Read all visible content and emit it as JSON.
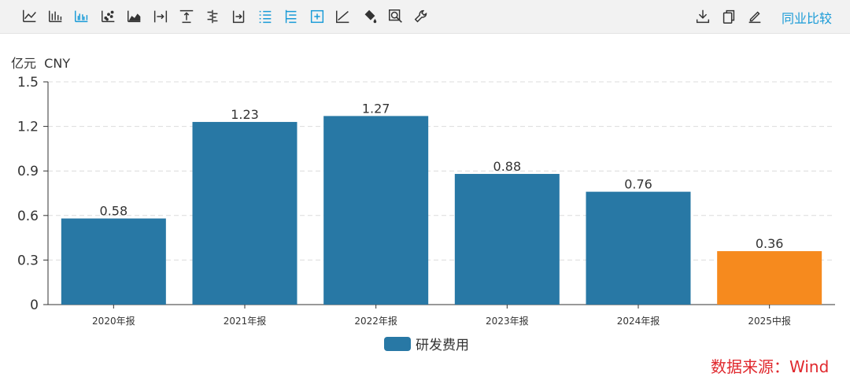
{
  "toolbar": {
    "left_tools": [
      {
        "icon": "line-chart-icon"
      },
      {
        "icon": "bar-chart-icon"
      },
      {
        "icon": "grouped-bar-chart-icon",
        "active": true
      },
      {
        "icon": "scatter-chart-icon"
      },
      {
        "icon": "area-chart-icon"
      },
      {
        "icon": "align-right-icon"
      },
      {
        "icon": "align-top-icon"
      },
      {
        "icon": "center-align-icon"
      },
      {
        "icon": "align-right-bar-icon"
      },
      {
        "icon": "list-lines-icon",
        "active": true
      },
      {
        "icon": "list-indent-icon",
        "active": true
      },
      {
        "icon": "add-box-icon",
        "active": true
      },
      {
        "icon": "trend-line-icon"
      },
      {
        "icon": "fill-color-icon"
      },
      {
        "icon": "zoom-icon"
      },
      {
        "icon": "wrench-icon"
      }
    ],
    "right_tools": [
      {
        "icon": "download-icon"
      },
      {
        "icon": "copy-icon"
      },
      {
        "icon": "edit-icon"
      }
    ],
    "peer_compare_label": "同业比较"
  },
  "colors": {
    "bar": "#2878a5",
    "highlight_bar": "#f68a1e",
    "source_text": "#e0282d",
    "active_icon": "#1a9bd7",
    "icon": "#333333"
  },
  "chart_data": {
    "type": "bar",
    "unit_label": "亿元  CNY",
    "categories": [
      "2020年报",
      "2021年报",
      "2022年报",
      "2023年报",
      "2024年报",
      "2025中报"
    ],
    "series": [
      {
        "name": "研发费用",
        "values": [
          0.58,
          1.23,
          1.27,
          0.88,
          0.76,
          0.36
        ]
      }
    ],
    "data_labels": [
      "0.58",
      "1.23",
      "1.27",
      "0.88",
      "0.76",
      "0.36"
    ],
    "highlight_index": 5,
    "ylim": [
      0,
      1.5
    ],
    "yticks": [
      0,
      0.3,
      0.6,
      0.9,
      1.2,
      1.5
    ],
    "ytick_labels": [
      "0",
      "0.3",
      "0.6",
      "0.9",
      "1.2",
      "1.5"
    ],
    "grid": true,
    "legend_position": "bottom-center"
  },
  "source": "数据来源：Wind"
}
